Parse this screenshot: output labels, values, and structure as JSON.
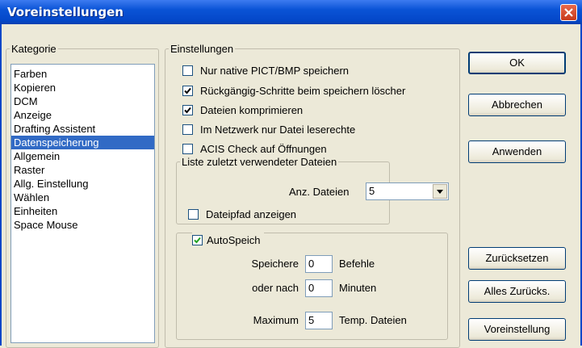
{
  "window": {
    "title": "Voreinstellungen"
  },
  "kategorie": {
    "legend": "Kategorie",
    "items": [
      "Farben",
      "Kopieren",
      "DCM",
      "Anzeige",
      "Drafting Assistent",
      "Datenspeicherung",
      "Allgemein",
      "Raster",
      "Allg. Einstellung",
      "Wählen",
      "Einheiten",
      "Space Mouse"
    ],
    "selected": "Datenspeicherung"
  },
  "einstellungen": {
    "legend": "Einstellungen",
    "options": [
      {
        "label": "Nur native PICT/BMP speichern",
        "checked": false
      },
      {
        "label": "Rückgängig-Schritte beim speichern löscher",
        "checked": true
      },
      {
        "label": "Dateien komprimieren",
        "checked": true
      },
      {
        "label": "Im Netzwerk nur Datei leserechte",
        "checked": false
      },
      {
        "label": "ACIS Check auf Öffnungen",
        "checked": false
      }
    ]
  },
  "recent": {
    "legend": "Liste zuletzt verwendeter Dateien",
    "count_label": "Anz. Dateien",
    "count_value": "5",
    "show_path_label": "Dateipfad anzeigen",
    "show_path_checked": false
  },
  "autosave": {
    "legend": "AutoSpeich",
    "checked": true,
    "rows": [
      {
        "prefix": "Speichere",
        "value": "0",
        "suffix": "Befehle"
      },
      {
        "prefix": "oder nach",
        "value": "0",
        "suffix": "Minuten"
      },
      {
        "prefix": "Maximum",
        "value": "5",
        "suffix": "Temp. Dateien"
      }
    ]
  },
  "buttons": {
    "ok": "OK",
    "cancel": "Abbrechen",
    "apply": "Anwenden",
    "reset": "Zurücksetzen",
    "reset_all": "Alles Zurücks.",
    "defaults": "Voreinstellung"
  }
}
